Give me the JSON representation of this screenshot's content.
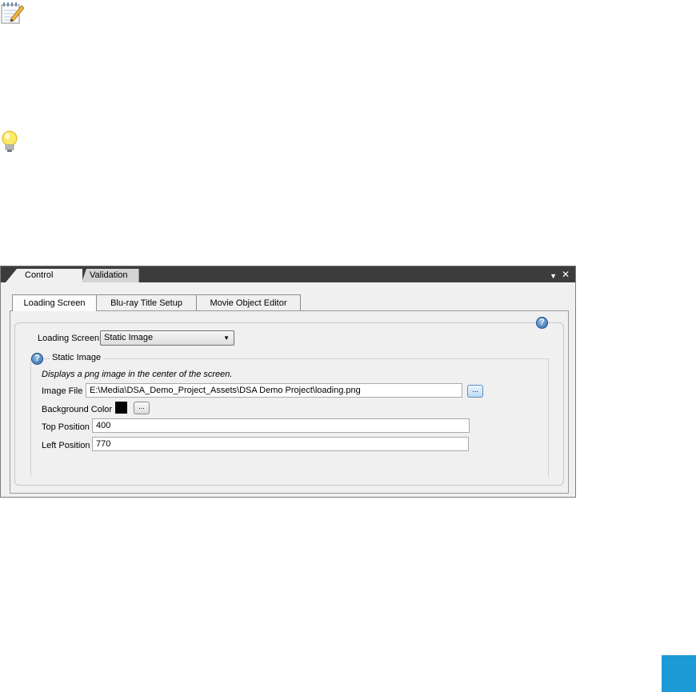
{
  "panel": {
    "dock_tabs": [
      "Control Panel",
      "Validation"
    ],
    "inner_tabs": [
      "Loading Screen",
      "Blu-ray Title Setup",
      "Movie Object Editor"
    ]
  },
  "form": {
    "loading_screen_label": "Loading Screen",
    "loading_screen_value": "Static Image",
    "group_title": "Static Image",
    "description": "Displays a png image in the center of the screen.",
    "image_file_label": "Image File",
    "image_file_value": "E:\\Media\\DSA_Demo_Project_Assets\\DSA Demo Project\\loading.png",
    "background_color_label": "Background Color",
    "background_color": "#000000",
    "top_position_label": "Top Position",
    "top_position_value": "400",
    "left_position_label": "Left Position",
    "left_position_value": "770",
    "browse_label": "..."
  },
  "icons": {
    "note": "notepad-pencil-icon",
    "tip": "lightbulb-icon",
    "help": "help-icon",
    "pin": "dropdown-arrow-icon",
    "close": "close-icon"
  },
  "help_glyph": "?",
  "pin_glyph": "▼",
  "close_glyph": "✕",
  "dropdown_glyph": "▼"
}
